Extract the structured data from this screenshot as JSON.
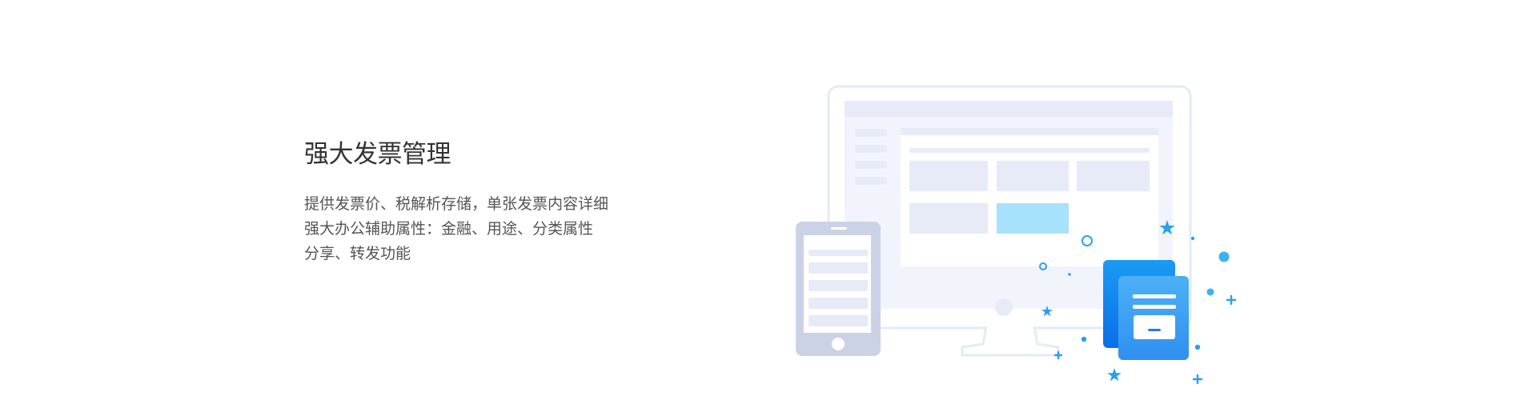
{
  "feature": {
    "title": "强大发票管理",
    "description_lines": [
      "提供发票价、税解析存储，单张发票内容详细",
      "强大办公辅助属性：金融、用途、分类属性",
      "分享、转发功能"
    ]
  },
  "illustration": {
    "icons": [
      "monitor-icon",
      "tablet-icon",
      "archive-box-icon",
      "star-icon",
      "plus-icon",
      "circle-icon"
    ],
    "colors": {
      "outline": "#e3ebf5",
      "panel": "#e6ebf7",
      "highlight": "#a8e1fb",
      "accent": "#1a95e6",
      "tablet": "#ccd2e6",
      "box_front": "#3aa0f3",
      "box_back": "#0d7ff0"
    }
  }
}
